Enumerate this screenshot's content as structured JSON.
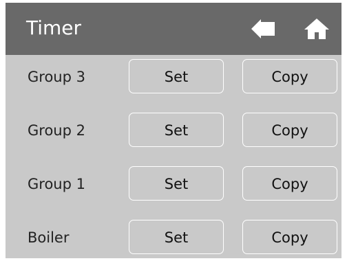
{
  "header": {
    "title": "Timer",
    "back_icon": "back-arrow-icon",
    "home_icon": "home-icon",
    "bg_color": "#696969"
  },
  "rows": [
    {
      "label": "Group 3",
      "set_label": "Set",
      "copy_label": "Copy"
    },
    {
      "label": "Group 2",
      "set_label": "Set",
      "copy_label": "Copy"
    },
    {
      "label": "Group 1",
      "set_label": "Set",
      "copy_label": "Copy"
    },
    {
      "label": "Boiler",
      "set_label": "Set",
      "copy_label": "Copy"
    }
  ],
  "colors": {
    "panel": "#c9c9c9",
    "button_border": "#ffffff",
    "text": "#222222"
  }
}
